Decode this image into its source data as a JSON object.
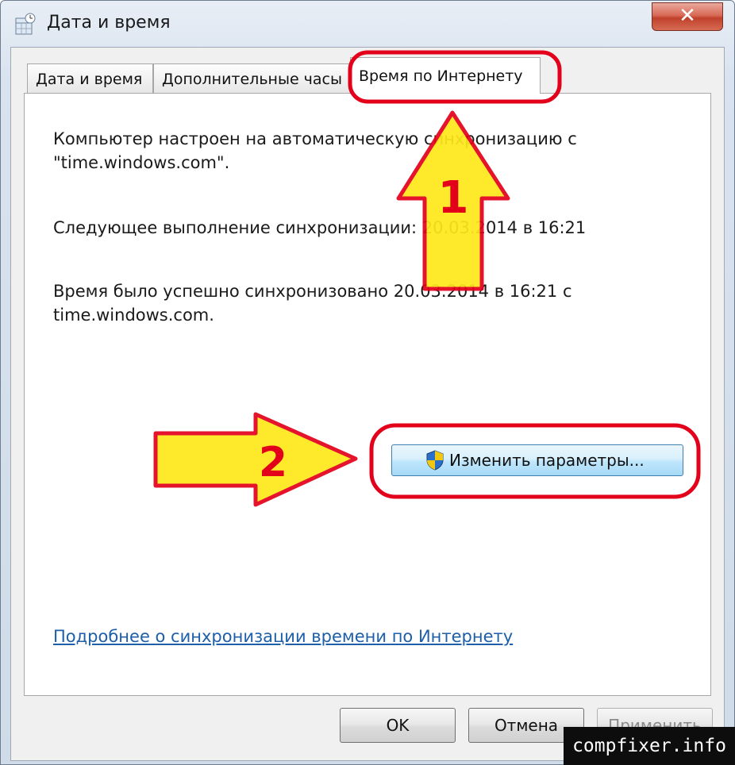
{
  "window": {
    "title": "Дата и время",
    "close_glyph": "✕"
  },
  "tabs": [
    {
      "label": "Дата и время",
      "active": false
    },
    {
      "label": "Дополнительные часы",
      "active": false
    },
    {
      "label": "Время по Интернету",
      "active": true
    }
  ],
  "content": {
    "line1": "Компьютер настроен на автоматическую синхронизацию с \"time.windows.com\".",
    "line2": "Следующее выполнение синхронизации: 20.03.2014 в 16:21",
    "line3": "Время было успешно синхронизовано 20.03.2014 в 16:21 с time.windows.com.",
    "change_button": "Изменить параметры...",
    "link": "Подробнее о синхронизации времени по Интернету"
  },
  "buttons": {
    "ok": "OK",
    "cancel": "Отмена",
    "apply": "Применить"
  },
  "annotations": {
    "arrow1_label": "1",
    "arrow2_label": "2",
    "highlight_color": "#e3001b",
    "arrow_fill": "#ffe81a"
  },
  "watermark": "compfixer.info",
  "icons": {
    "app": "calendar-clock-icon",
    "shield": "uac-shield-icon"
  }
}
